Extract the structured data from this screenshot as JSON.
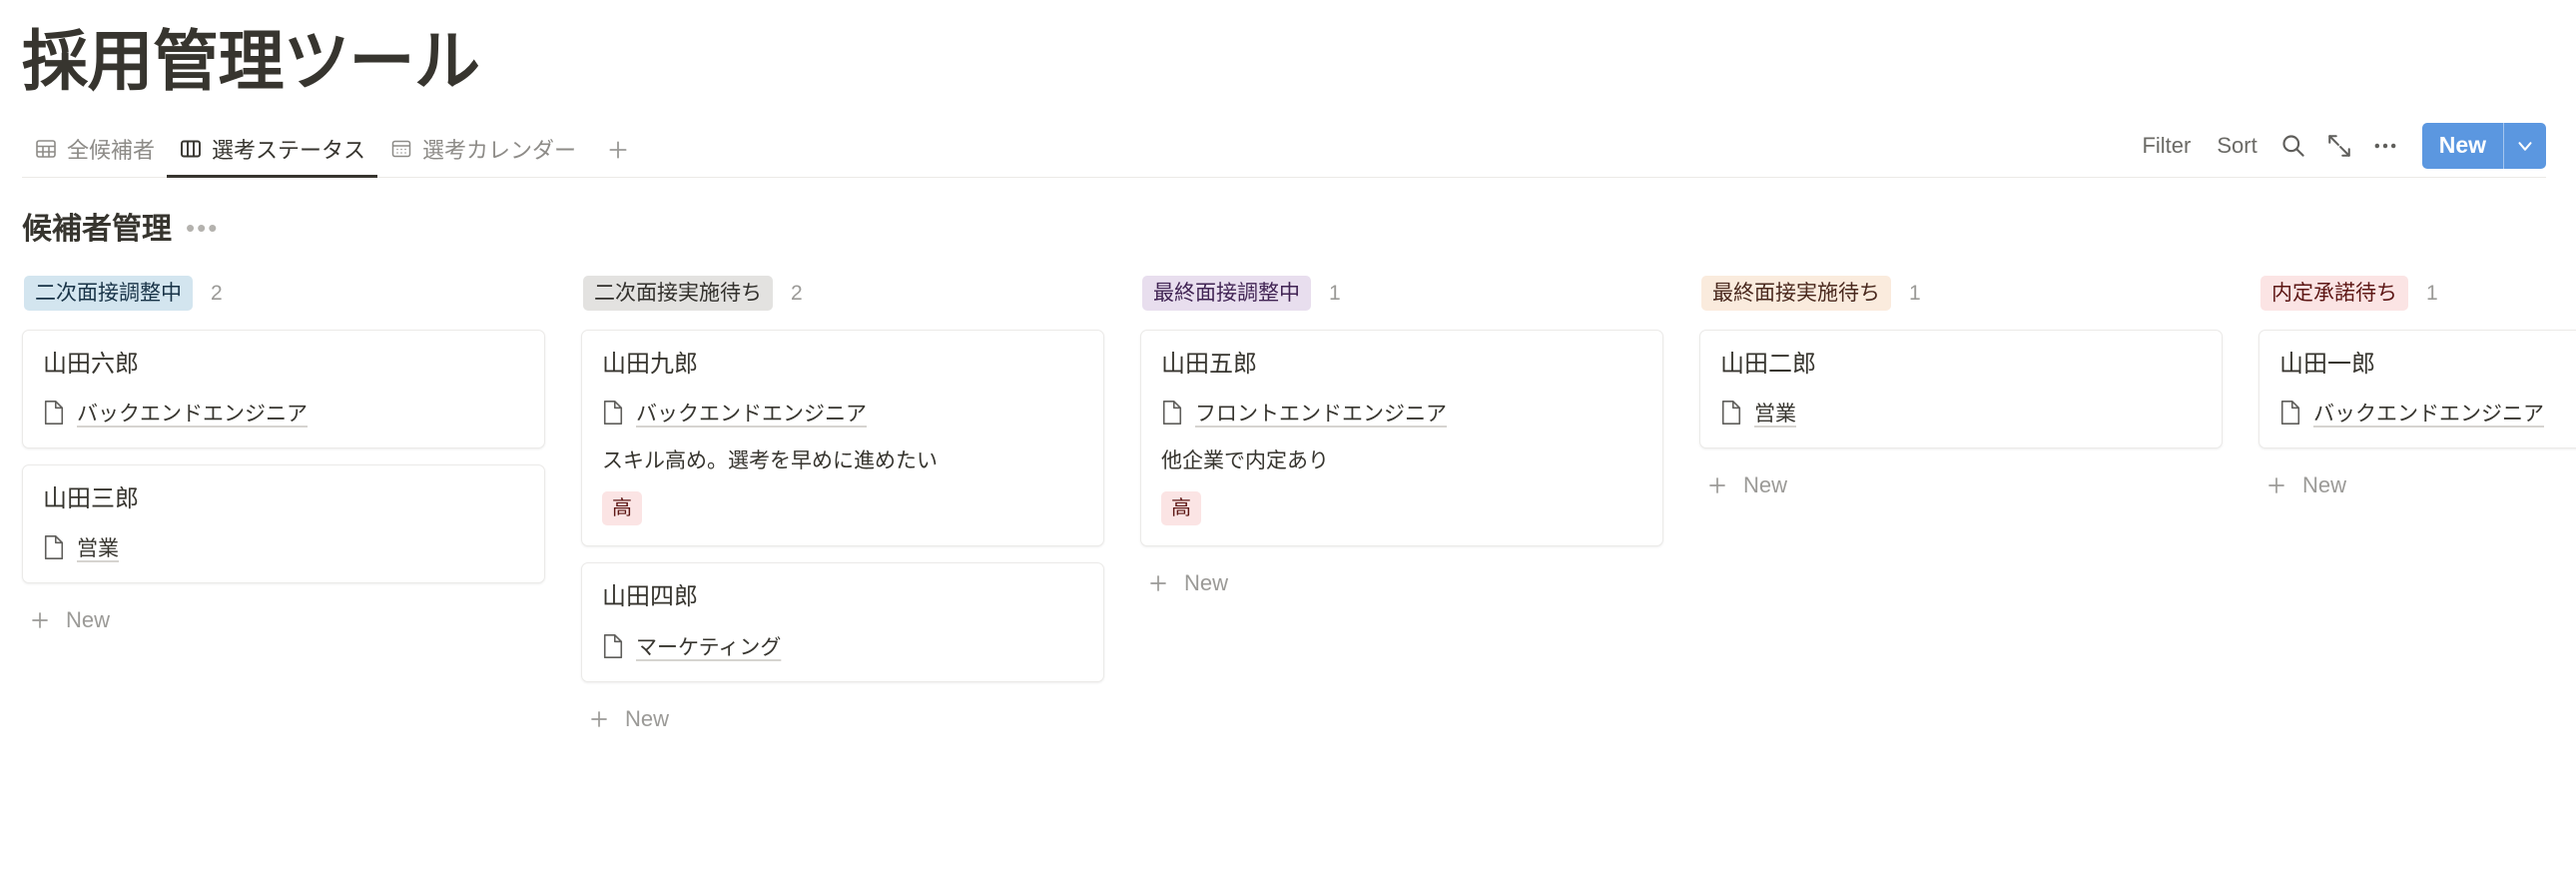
{
  "header": {
    "title": "採用管理ツール"
  },
  "tabs": [
    {
      "label": "全候補者",
      "icon": "table-icon",
      "active": false
    },
    {
      "label": "選考ステータス",
      "icon": "board-icon",
      "active": true
    },
    {
      "label": "選考カレンダー",
      "icon": "calendar-icon",
      "active": false
    }
  ],
  "tab_add_label": "+",
  "toolbar": {
    "filter_label": "Filter",
    "sort_label": "Sort",
    "search_icon": "search-icon",
    "expand_icon": "expand-icon",
    "more_icon": "ellipsis-icon",
    "new_label": "New",
    "new_caret_icon": "chevron-down-icon",
    "accent_color": "#5b97e0"
  },
  "section": {
    "title": "候補者管理",
    "menu_dots": "•••"
  },
  "new_row_label": "New",
  "board": {
    "columns": [
      {
        "status": "二次面接調整中",
        "count": "2",
        "badge_bg": "#d3e5ef",
        "badge_fg": "#183347",
        "cards": [
          {
            "name": "山田六郎",
            "role": "バックエンドエンジニア",
            "note": "",
            "tag": ""
          },
          {
            "name": "山田三郎",
            "role": "営業",
            "note": "",
            "tag": ""
          }
        ]
      },
      {
        "status": "二次面接実施待ち",
        "count": "2",
        "badge_bg": "#e3e2e0",
        "badge_fg": "#32302c",
        "cards": [
          {
            "name": "山田九郎",
            "role": "バックエンドエンジニア",
            "note": "スキル高め。選考を早めに進めたい",
            "tag": "高"
          },
          {
            "name": "山田四郎",
            "role": "マーケティング",
            "note": "",
            "tag": ""
          }
        ]
      },
      {
        "status": "最終面接調整中",
        "count": "1",
        "badge_bg": "#e8deee",
        "badge_fg": "#412454",
        "cards": [
          {
            "name": "山田五郎",
            "role": "フロントエンドエンジニア",
            "note": "他企業で内定あり",
            "tag": "高"
          }
        ]
      },
      {
        "status": "最終面接実施待ち",
        "count": "1",
        "badge_bg": "#faebdd",
        "badge_fg": "#49281d",
        "cards": [
          {
            "name": "山田二郎",
            "role": "営業",
            "note": "",
            "tag": ""
          }
        ]
      },
      {
        "status": "内定承諾待ち",
        "count": "1",
        "badge_bg": "#fbe4e4",
        "badge_fg": "#5d1715",
        "cards": [
          {
            "name": "山田一郎",
            "role": "バックエンドエンジニア",
            "note": "",
            "tag": ""
          }
        ]
      }
    ]
  }
}
